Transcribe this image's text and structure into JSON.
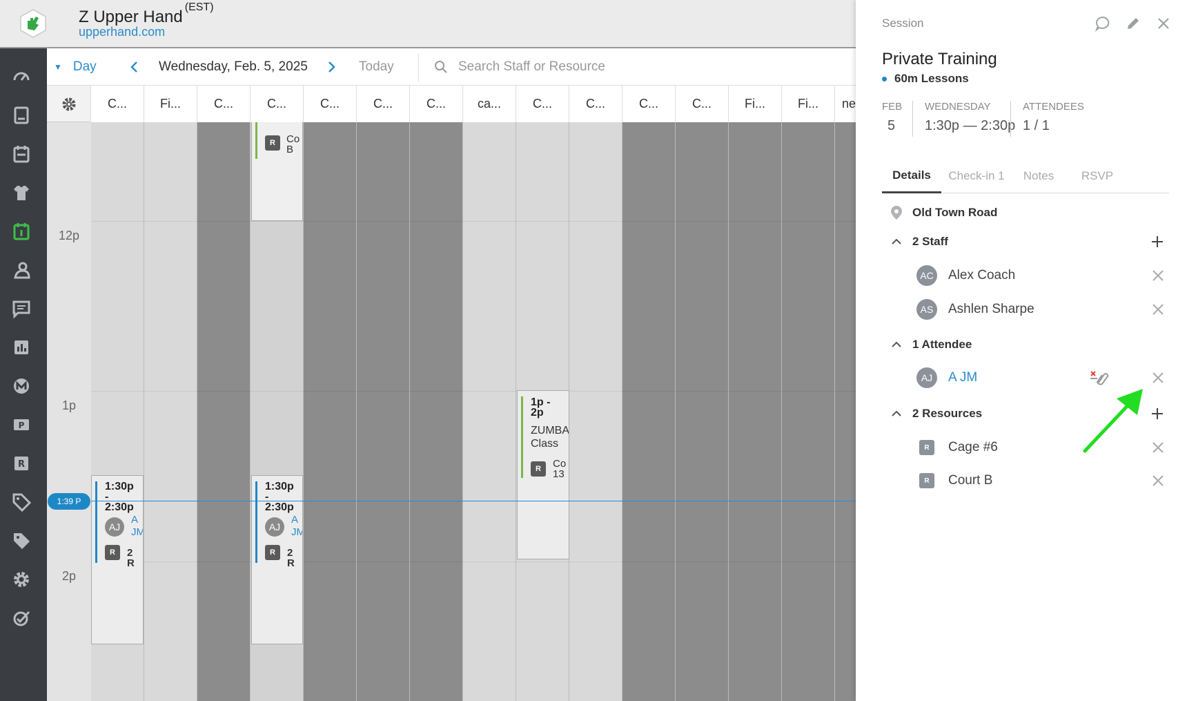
{
  "header": {
    "org_name": "Z Upper Hand",
    "timezone": "(EST)",
    "org_url": "upperhand.com"
  },
  "sidebar": {
    "items": [
      "dashboard-icon",
      "clipboard-icon",
      "calendar-list-icon",
      "jersey-icon",
      "calendar-icon",
      "team-icon",
      "messages-icon",
      "reports-icon",
      "marketing-icon",
      "point-of-sale-icon",
      "resources-icon",
      "discount-tag-icon",
      "tags-icon",
      "settings-icon",
      "tasks-icon"
    ],
    "active": "calendar-icon"
  },
  "toolbar": {
    "view": "Day",
    "date": "Wednesday, Feb. 5, 2025",
    "today": "Today",
    "search_placeholder": "Search Staff or Resource"
  },
  "columns": [
    "C...",
    "Fi...",
    "C...",
    "C...",
    "C...",
    "C...",
    "C...",
    "ca...",
    "C...",
    "C...",
    "C...",
    "C...",
    "Fi...",
    "Fi...",
    "ne"
  ],
  "times": [
    "12p",
    "1p",
    "2p"
  ],
  "now": "1:39 P",
  "events": {
    "e1": {
      "badge": "R",
      "text_a": "Co",
      "text_b": "B"
    },
    "e2": {
      "time_a": "1:30p",
      "time_b": "-",
      "time_c": "2:30p",
      "avatar": "AJ",
      "link_a": "A",
      "link_b": "JM",
      "badge": "R",
      "res": "2 R"
    },
    "e3": {
      "time_a": "1:30p",
      "time_b": "-",
      "time_c": "2:30p",
      "avatar": "AJ",
      "link_a": "A",
      "link_b": "JM",
      "badge": "R",
      "res": "2 R"
    },
    "e4": {
      "time_a": "1p -",
      "time_b": "2p",
      "name_a": "ZUMBA",
      "name_b": "Class",
      "badge": "R",
      "res_a": "Co",
      "res_b": "13"
    }
  },
  "panel": {
    "label": "Session",
    "title": "Private Training",
    "subtitle": "60m Lessons",
    "date_key": "FEB",
    "date_val": "5",
    "day_key": "WEDNESDAY",
    "day_val": "1:30p — 2:30p",
    "att_key": "ATTENDEES",
    "att_val": "1 / 1",
    "tabs": [
      "Details",
      "Check-in 1",
      "Notes",
      "RSVP"
    ],
    "location": "Old Town Road",
    "staff_heading": "2 Staff",
    "staff": [
      {
        "initials": "AC",
        "name": "Alex Coach"
      },
      {
        "initials": "AS",
        "name": "Ashlen Sharpe"
      }
    ],
    "attendee_heading": "1 Attendee",
    "attendees": [
      {
        "initials": "AJ",
        "name": "A JM"
      }
    ],
    "resources_heading": "2 Resources",
    "resources": [
      {
        "badge": "R",
        "name": "Cage #6"
      },
      {
        "badge": "R",
        "name": "Court B"
      }
    ]
  },
  "colors": {
    "accent": "#2b8bcb",
    "sidebar": "#3a3d41",
    "active_icon": "#3fbf4a",
    "annotation_arrow": "#22dd22"
  }
}
